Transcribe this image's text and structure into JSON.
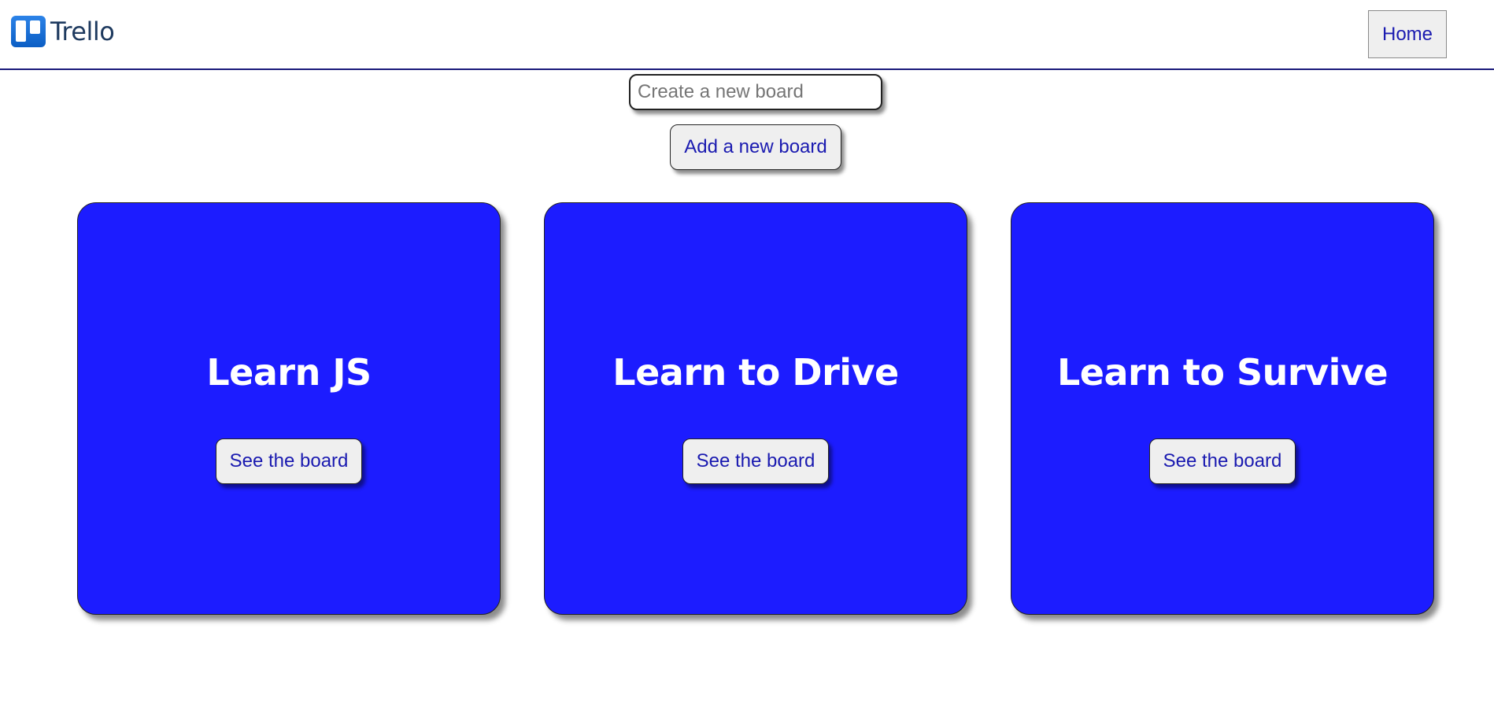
{
  "header": {
    "logo_text": "Trello",
    "home_label": "Home"
  },
  "create": {
    "placeholder": "Create a new board",
    "value": "",
    "add_label": "Add a new board"
  },
  "boards": [
    {
      "title": "Learn JS",
      "button_label": "See the board"
    },
    {
      "title": "Learn to Drive",
      "button_label": "See the board"
    },
    {
      "title": "Learn to Survive",
      "button_label": "See the board"
    }
  ],
  "colors": {
    "card_background": "#1c1cff",
    "button_text": "#1a1ab0",
    "header_border": "#1a1a7a"
  }
}
